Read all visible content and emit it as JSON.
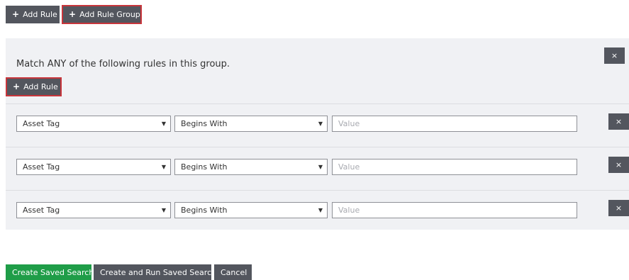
{
  "top_toolbar": {
    "add_rule_label": "Add Rule",
    "add_rule_group_label": "Add Rule Group"
  },
  "group": {
    "description": "Match ANY of the following rules in this group.",
    "add_rule_label": "Add Rule",
    "close_glyph": "×",
    "rules": [
      {
        "field": "Asset Tag",
        "operator": "Begins With",
        "value": "",
        "value_placeholder": "Value"
      },
      {
        "field": "Asset Tag",
        "operator": "Begins With",
        "value": "",
        "value_placeholder": "Value"
      },
      {
        "field": "Asset Tag",
        "operator": "Begins With",
        "value": "",
        "value_placeholder": "Value"
      }
    ]
  },
  "footer": {
    "create_saved_label": "Create Saved Search",
    "create_run_label": "Create and Run Saved Search",
    "cancel_label": "Cancel"
  },
  "icons": {
    "plus": "+",
    "caret": "▼",
    "close": "×"
  },
  "colors": {
    "button_dark": "#53565e",
    "button_green": "#1f9d48",
    "focus_outline": "#c8353b",
    "group_bg": "#f0f1f4"
  }
}
